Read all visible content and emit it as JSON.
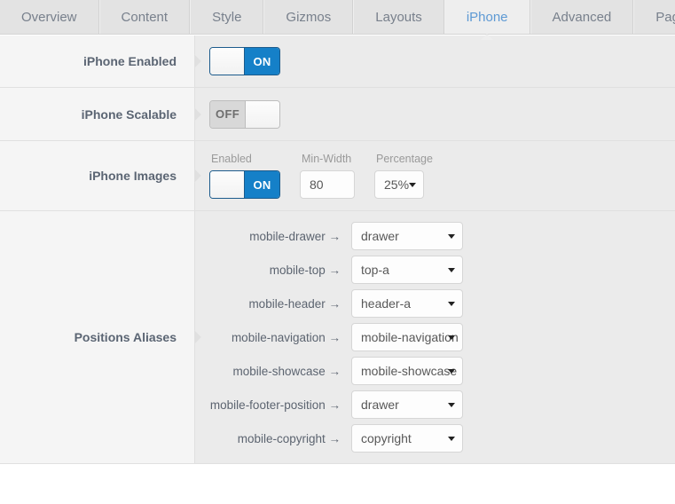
{
  "tabs": [
    {
      "label": "Overview",
      "active": false
    },
    {
      "label": "Content",
      "active": false
    },
    {
      "label": "Style",
      "active": false
    },
    {
      "label": "Gizmos",
      "active": false
    },
    {
      "label": "Layouts",
      "active": false
    },
    {
      "label": "iPhone",
      "active": true
    },
    {
      "label": "Advanced",
      "active": false
    },
    {
      "label": "Page Templates",
      "active": false
    }
  ],
  "rows": {
    "iphone_enabled": {
      "label": "iPhone Enabled",
      "toggle": {
        "state": "on",
        "on_label": "ON",
        "off_label": "OFF"
      }
    },
    "iphone_scalable": {
      "label": "iPhone Scalable",
      "toggle": {
        "state": "off",
        "on_label": "ON",
        "off_label": "OFF"
      }
    },
    "iphone_images": {
      "label": "iPhone Images",
      "enabled": {
        "label": "Enabled",
        "toggle": {
          "state": "on",
          "on_label": "ON",
          "off_label": "OFF"
        }
      },
      "min_width": {
        "label": "Min-Width",
        "value": "80",
        "placeholder": "80"
      },
      "percentage": {
        "label": "Percentage",
        "value": "25%"
      }
    },
    "positions_aliases": {
      "label": "Positions Aliases",
      "items": [
        {
          "name": "mobile-drawer →",
          "value": "drawer"
        },
        {
          "name": "mobile-top →",
          "value": "top-a"
        },
        {
          "name": "mobile-header →",
          "value": "header-a"
        },
        {
          "name": "mobile-navigation →",
          "value": "mobile-navigation"
        },
        {
          "name": "mobile-showcase →",
          "value": "mobile-showcase"
        },
        {
          "name": "mobile-footer-position →",
          "value": "drawer"
        },
        {
          "name": "mobile-copyright →",
          "value": "copyright"
        }
      ]
    }
  },
  "colors": {
    "accent_blue": "#1580c8",
    "active_tab_text": "#5e9ad4",
    "tab_text": "#78808c",
    "label_text": "#5b6573",
    "panel_bg": "#ebebeb",
    "label_bg": "#f5f5f5",
    "tabbar_bg": "#e3e3e3"
  }
}
